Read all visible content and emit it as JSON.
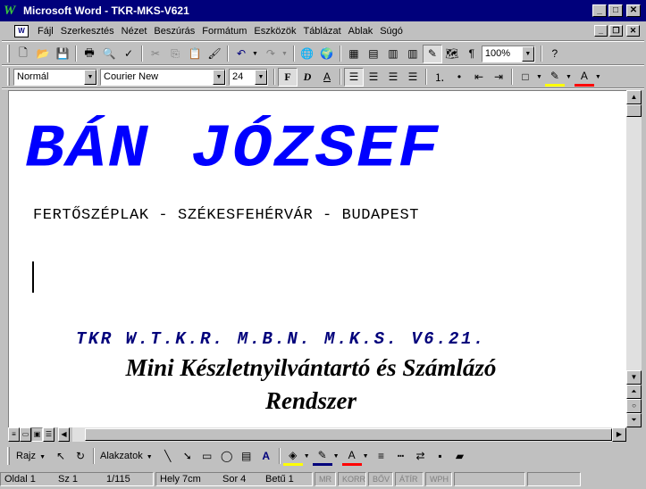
{
  "window": {
    "title": "Microsoft Word - TKR-MKS-V621"
  },
  "menu": [
    "Fájl",
    "Szerkesztés",
    "Nézet",
    "Beszúrás",
    "Formátum",
    "Eszközök",
    "Táblázat",
    "Ablak",
    "Súgó"
  ],
  "standard_toolbar": {
    "zoom": "100%"
  },
  "formatting_toolbar": {
    "style": "Normál",
    "font": "Courier New",
    "size": "24"
  },
  "document": {
    "title": "BÁN JÓZSEF",
    "subtitle": "FERTŐSZÉPLAK - SZÉKESFEHÉRVÁR - BUDAPEST",
    "product": "TKR W.T.K.R. M.B.N. M.K.S. V6.21.",
    "description_line1": "Mini Készletnyilvántartó és Számlázó",
    "description_line2": "Rendszer"
  },
  "drawing_toolbar": {
    "draw": "Rajz",
    "autoshapes": "Alakzatok"
  },
  "status_bar": {
    "page": "Oldal 1",
    "section": "Sz 1",
    "pages": "1/115",
    "position": "Hely 7cm",
    "line": "Sor 4",
    "column": "Betű 1",
    "flags": [
      "MR",
      "KORR",
      "BŐV",
      "ÁTÍR",
      "WPH"
    ]
  },
  "colors": {
    "title_blue": "#0000ff",
    "product_navy": "#00007b",
    "titlebar": "#00007b"
  }
}
